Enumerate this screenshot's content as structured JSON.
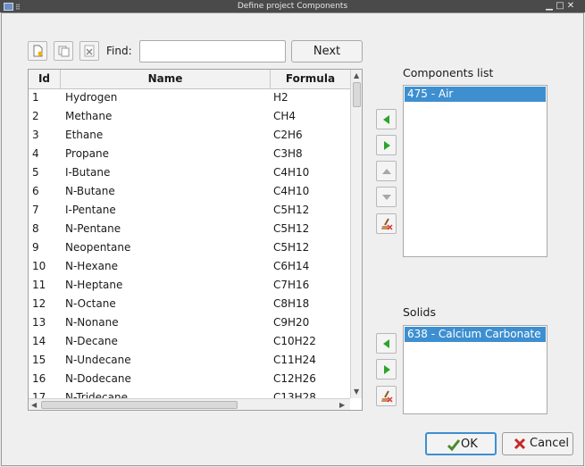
{
  "window": {
    "title": "Define project Components"
  },
  "toolbar": {
    "find_label": "Find:",
    "find_value": "",
    "next_label": "Next"
  },
  "table": {
    "headers": {
      "id": "Id",
      "name": "Name",
      "formula": "Formula"
    },
    "rows": [
      {
        "id": "1",
        "name": "Hydrogen",
        "formula": "H2"
      },
      {
        "id": "2",
        "name": "Methane",
        "formula": "CH4"
      },
      {
        "id": "3",
        "name": "Ethane",
        "formula": "C2H6"
      },
      {
        "id": "4",
        "name": "Propane",
        "formula": "C3H8"
      },
      {
        "id": "5",
        "name": "I-Butane",
        "formula": "C4H10"
      },
      {
        "id": "6",
        "name": "N-Butane",
        "formula": "C4H10"
      },
      {
        "id": "7",
        "name": "I-Pentane",
        "formula": "C5H12"
      },
      {
        "id": "8",
        "name": "N-Pentane",
        "formula": "C5H12"
      },
      {
        "id": "9",
        "name": "Neopentane",
        "formula": "C5H12"
      },
      {
        "id": "10",
        "name": "N-Hexane",
        "formula": "C6H14"
      },
      {
        "id": "11",
        "name": "N-Heptane",
        "formula": "C7H16"
      },
      {
        "id": "12",
        "name": "N-Octane",
        "formula": "C8H18"
      },
      {
        "id": "13",
        "name": "N-Nonane",
        "formula": "C9H20"
      },
      {
        "id": "14",
        "name": "N-Decane",
        "formula": "C10H22"
      },
      {
        "id": "15",
        "name": "N-Undecane",
        "formula": "C11H24"
      },
      {
        "id": "16",
        "name": "N-Dodecane",
        "formula": "C12H26"
      },
      {
        "id": "17",
        "name": "N-Tridecane",
        "formula": "C13H28"
      }
    ]
  },
  "components": {
    "label": "Components list",
    "items": [
      "475 - Air"
    ]
  },
  "solids": {
    "label": "Solids",
    "items": [
      "638 - Calcium Carbonate"
    ]
  },
  "buttons": {
    "ok": "OK",
    "cancel": "Cancel"
  }
}
